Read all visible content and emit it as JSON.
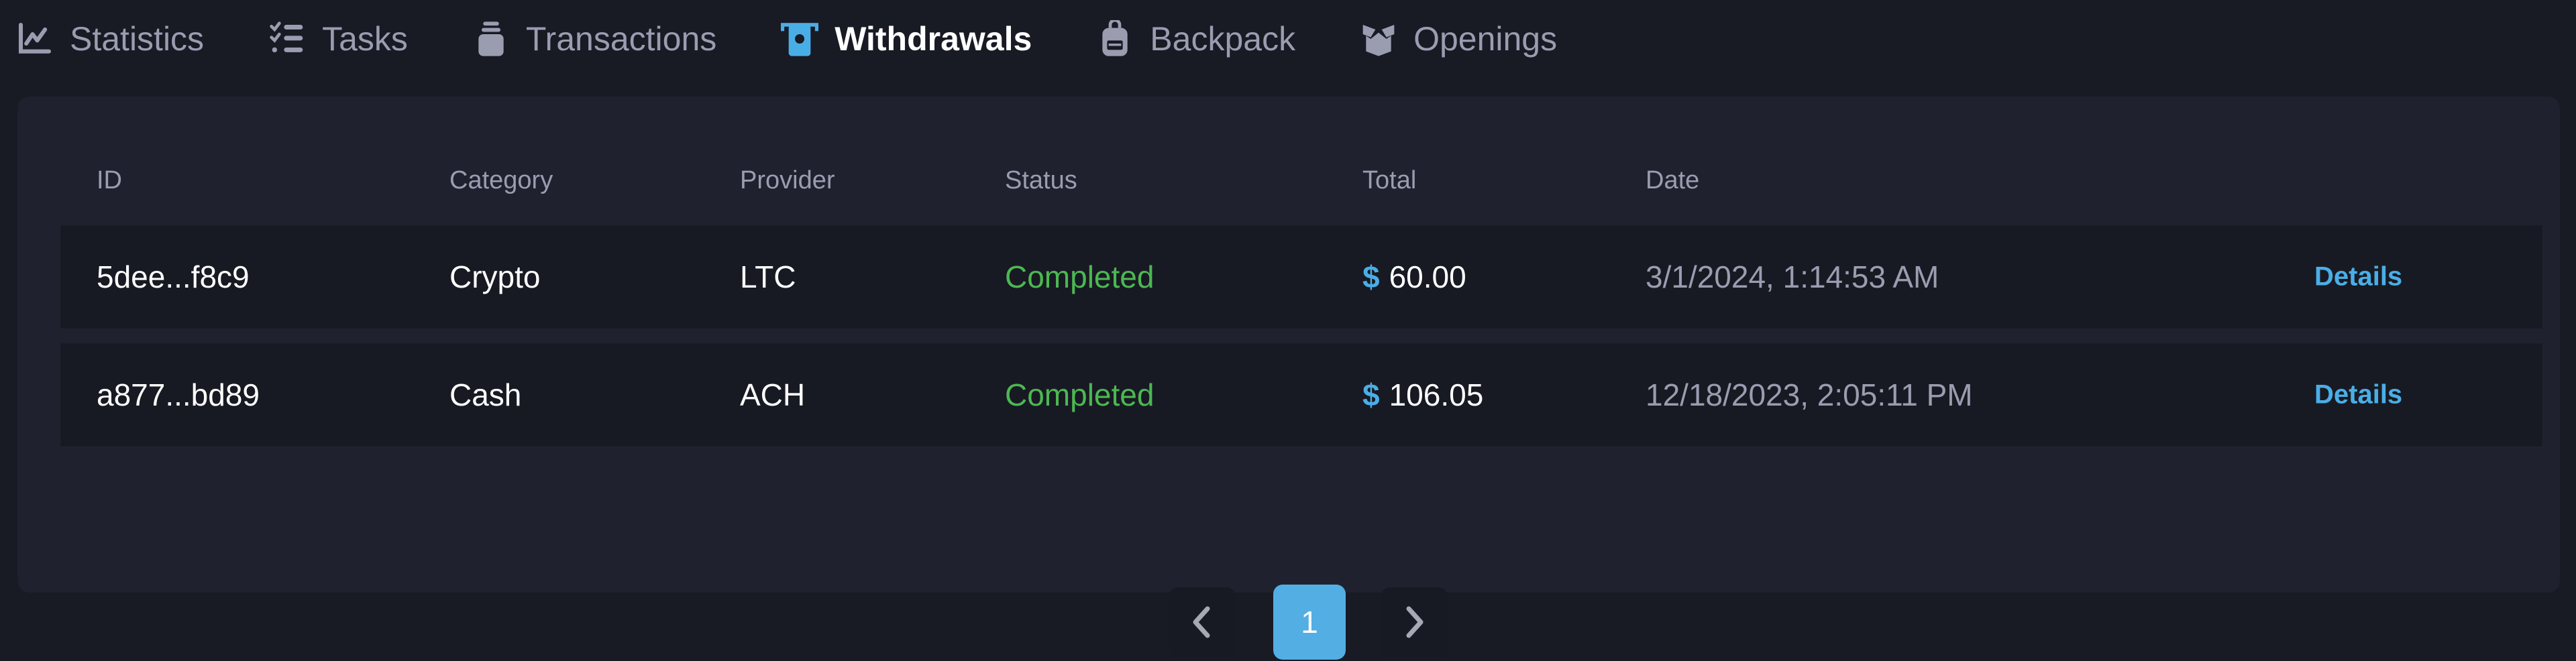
{
  "tabs": [
    {
      "label": "Statistics",
      "icon": "chart-line-icon",
      "active": false
    },
    {
      "label": "Tasks",
      "icon": "checklist-icon",
      "active": false
    },
    {
      "label": "Transactions",
      "icon": "coin-stack-icon",
      "active": false
    },
    {
      "label": "Withdrawals",
      "icon": "atm-withdraw-icon",
      "active": true
    },
    {
      "label": "Backpack",
      "icon": "backpack-icon",
      "active": false
    },
    {
      "label": "Openings",
      "icon": "box-open-icon",
      "active": false
    }
  ],
  "table": {
    "columns": [
      "ID",
      "Category",
      "Provider",
      "Status",
      "Total",
      "Date"
    ],
    "rows": [
      {
        "id": "5dee...f8c9",
        "category": "Crypto",
        "provider": "LTC",
        "status": "Completed",
        "currency": "$",
        "total": "60.00",
        "date": "3/1/2024, 1:14:53 AM",
        "action": "Details"
      },
      {
        "id": "a877...bd89",
        "category": "Cash",
        "provider": "ACH",
        "status": "Completed",
        "currency": "$",
        "total": "106.05",
        "date": "12/18/2023, 2:05:11 PM",
        "action": "Details"
      }
    ]
  },
  "pagination": {
    "current_page": "1",
    "prev_icon": "chevron-left-icon",
    "next_icon": "chevron-right-icon"
  },
  "colors": {
    "accent": "#53aee3",
    "status_completed": "#4cb852",
    "background": "#181a24",
    "panel": "#1f222e"
  }
}
